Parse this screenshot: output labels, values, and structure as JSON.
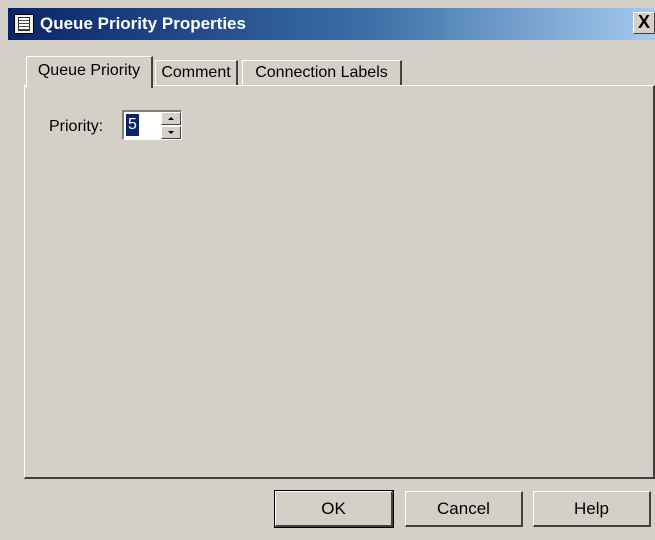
{
  "window": {
    "title": "Queue Priority Properties",
    "close_label": "X"
  },
  "tabs": [
    {
      "label": "Queue Priority",
      "active": true
    },
    {
      "label": "Comment",
      "active": false
    },
    {
      "label": "Connection Labels",
      "active": false
    }
  ],
  "priority": {
    "label": "Priority:",
    "value": "5"
  },
  "buttons": {
    "ok": "OK",
    "cancel": "Cancel",
    "help": "Help"
  },
  "colors": {
    "titlebar_start": "#0a246a",
    "titlebar_end": "#a6caf0",
    "dialog_bg": "#d4d0c8",
    "selection": "#0a246a"
  }
}
